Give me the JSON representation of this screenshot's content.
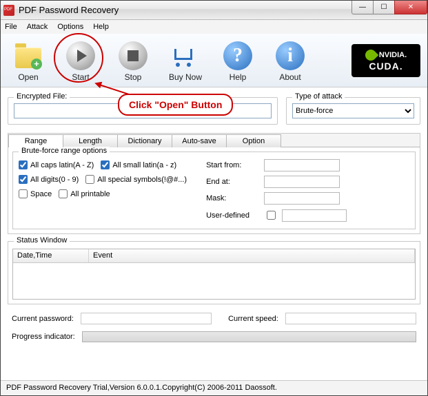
{
  "window": {
    "title": "PDF Password Recovery"
  },
  "menu": {
    "file": "File",
    "attack": "Attack",
    "options": "Options",
    "help": "Help"
  },
  "toolbar": {
    "open": "Open",
    "start": "Start",
    "stop": "Stop",
    "buynow": "Buy Now",
    "help": "Help",
    "about": "About"
  },
  "annotation": {
    "text": "Click \"Open\" Button"
  },
  "encrypted": {
    "label": "Encrypted File:",
    "value": ""
  },
  "attack_type": {
    "label": "Type of attack",
    "selected": "Brute-force"
  },
  "tabs": {
    "range": "Range",
    "length": "Length",
    "dictionary": "Dictionary",
    "autosave": "Auto-save",
    "option": "Option"
  },
  "brute": {
    "title": "Brute-force range options",
    "caps": "All caps latin(A - Z)",
    "small": "All small latin(a - z)",
    "digits": "All digits(0 - 9)",
    "symbols": "All special symbols(!@#...)",
    "space": "Space",
    "printable": "All printable",
    "start_from": "Start from:",
    "end_at": "End at:",
    "mask": "Mask:",
    "user_defined": "User-defined"
  },
  "status": {
    "title": "Status Window",
    "col1": "Date,Time",
    "col2": "Event"
  },
  "current_password_label": "Current password:",
  "current_speed_label": "Current speed:",
  "progress_label": "Progress indicator:",
  "footer": "PDF Password Recovery Trial,Version 6.0.0.1.Copyright(C) 2006-2011 Daossoft.",
  "cuda": {
    "brand": "NVIDIA.",
    "product": "CUDA."
  }
}
